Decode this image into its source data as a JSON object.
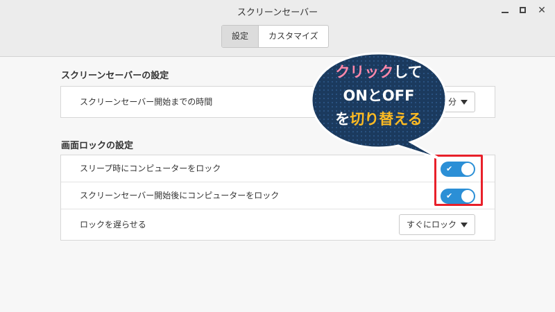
{
  "window": {
    "title": "スクリーンセーバー",
    "close_glyph": "✕"
  },
  "tabs": [
    {
      "label": "設定",
      "active": true
    },
    {
      "label": "カスタマイズ",
      "active": false
    }
  ],
  "screensaver_section": {
    "title": "スクリーンセーバーの設定",
    "rows": [
      {
        "label": "スクリーンセーバー開始までの時間",
        "dropdown_value": "分"
      }
    ]
  },
  "lock_section": {
    "title": "画面ロックの設定",
    "rows": [
      {
        "label": "スリープ時にコンピューターをロック",
        "toggle_on": true
      },
      {
        "label": "スクリーンセーバー開始後にコンピューターをロック",
        "toggle_on": true
      },
      {
        "label": "ロックを遅らせる",
        "dropdown_value": "すぐにロック"
      }
    ]
  },
  "toggle_check": "✔",
  "annotation": {
    "line1_highlight": "クリック",
    "line1_rest": "して",
    "line2": "ONとOFF",
    "line3_prefix": "を",
    "line3_highlight": "切り替える",
    "colors": {
      "bubble": "#1b3a5e",
      "highlight": "#ff88aa",
      "accent": "#ffbb22",
      "frame": "#e8202a"
    }
  }
}
